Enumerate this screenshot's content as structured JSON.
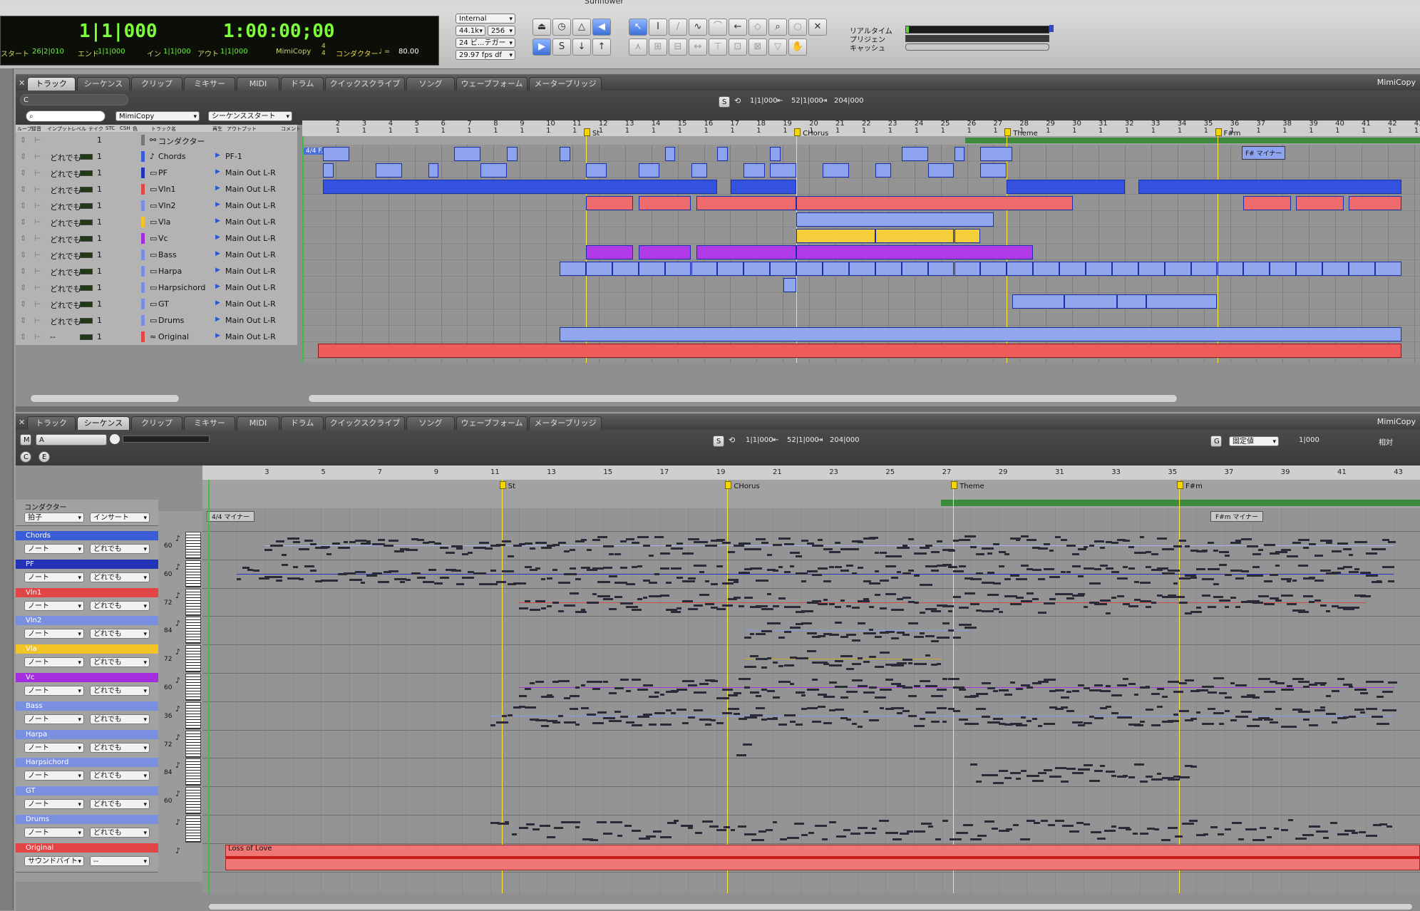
{
  "window_title": "Sunflower",
  "transport": {
    "counter_main": "1|1|000",
    "counter_time": "1:00:00;00",
    "start_label": "スタート",
    "start_value": "26|2|010",
    "end_label": "エンド",
    "end_value": "1|1|000",
    "in_label": "イン",
    "in_value": "1|1|000",
    "out_label": "アウト",
    "out_value": "1|1|000",
    "mode": "MimiCopy",
    "meter_top": "4",
    "meter_bottom": "4",
    "conductor_label": "コンダクター",
    "tempo_value": "80.00",
    "sync_source": "Internal",
    "sample_rate": "44.1k",
    "buffer": "256",
    "bit_depth": "24 ビ...テガー",
    "fps": "29.97 fps df",
    "realtime_label": "リアルタイム",
    "preroll_label": "プリジェン",
    "cache_label": "キャッシュ",
    "realtime_load": 0.02
  },
  "tabs": [
    "トラック",
    "シーケンス",
    "クリップ",
    "ミキサー",
    "MIDI",
    "ドラム",
    "クイックスクライブ",
    "ソング",
    "ウェーブフォーム",
    "メーターブリッジ"
  ],
  "top_window": {
    "active_tab": 0,
    "window_label": "MimiCopy",
    "label_c": "C",
    "search_placeholder": "",
    "seq_select": "MimiCopy",
    "start_select": "シーケンススタート",
    "counter_s": "S",
    "counter_start": "1|1|000",
    "counter_end": "52|1|000",
    "counter_len": "204|000",
    "columns": [
      "ループ",
      "録音",
      "インプット",
      "レベル",
      "テイク",
      "STC",
      "CSH",
      "色",
      "トラック名",
      "再生",
      "アウトプット",
      "コメント"
    ],
    "tracks": [
      {
        "input": "",
        "take": "1",
        "name": "コンダクター",
        "output": "",
        "color": "#777777"
      },
      {
        "input": "どれでも",
        "take": "1",
        "name": "Chords",
        "output": "PF-1",
        "color": "#3a5dd6"
      },
      {
        "input": "どれでも",
        "take": "1",
        "name": "PF",
        "output": "Main Out L-R",
        "color": "#2233b8"
      },
      {
        "input": "どれでも",
        "take": "1",
        "name": "Vln1",
        "output": "Main Out L-R",
        "color": "#e24545"
      },
      {
        "input": "どれでも",
        "take": "1",
        "name": "Vln2",
        "output": "Main Out L-R",
        "color": "#7b8fe0"
      },
      {
        "input": "どれでも",
        "take": "1",
        "name": "Vla",
        "output": "Main Out L-R",
        "color": "#f3c425"
      },
      {
        "input": "どれでも",
        "take": "1",
        "name": "Vc",
        "output": "Main Out L-R",
        "color": "#a52de0"
      },
      {
        "input": "どれでも",
        "take": "1",
        "name": "Bass",
        "output": "Main Out L-R",
        "color": "#7b8fe0"
      },
      {
        "input": "どれでも",
        "take": "1",
        "name": "Harpa",
        "output": "Main Out L-R",
        "color": "#7b8fe0"
      },
      {
        "input": "どれでも",
        "take": "1",
        "name": "Harpsichord",
        "output": "Main Out L-R",
        "color": "#7b8fe0"
      },
      {
        "input": "どれでも",
        "take": "1",
        "name": "GT",
        "output": "Main Out L-R",
        "color": "#7b8fe0"
      },
      {
        "input": "どれでも",
        "take": "1",
        "name": "Drums",
        "output": "Main Out L-R",
        "color": "#7b8fe0"
      },
      {
        "input": "--",
        "take": "1",
        "name": "Original",
        "output": "Main Out L-R",
        "color": "#e24545"
      }
    ],
    "markers": [
      {
        "label": "St",
        "measure": 12
      },
      {
        "label": "CHorus",
        "measure": 20
      },
      {
        "label": "Theme",
        "measure": 28
      },
      {
        "label": "F#m",
        "measure": 36
      }
    ],
    "conductor_text": "4/4 F...",
    "key_text": "F# マイナー"
  },
  "bottom_window": {
    "active_tab": 1,
    "window_label": "MimiCopy",
    "btn_m": "M",
    "btn_a": "A",
    "btn_c": "C",
    "btn_e": "E",
    "counter_s": "S",
    "counter_start": "1|1|000",
    "counter_end": "52|1|000",
    "counter_len": "204|000",
    "grid_g": "G",
    "grid_select": "固定値",
    "grid_value": "1|000",
    "relative_label": "相対",
    "conductor_name": "コンダクター",
    "conductor_select1": "拍子",
    "conductor_select2": "インサート",
    "meter_text": "4/4 マイナー",
    "key_text": "F#m マイナー",
    "audio_label": "Loss of Love",
    "tracks": [
      {
        "name": "Chords",
        "sel1": "ノート",
        "sel2": "どれでも",
        "pitch": "60",
        "color": "#3a5dd6"
      },
      {
        "name": "PF",
        "sel1": "ノート",
        "sel2": "どれでも",
        "pitch": "60",
        "color": "#2233b8"
      },
      {
        "name": "Vln1",
        "sel1": "ノート",
        "sel2": "どれでも",
        "pitch": "72",
        "color": "#e24545"
      },
      {
        "name": "Vln2",
        "sel1": "ノート",
        "sel2": "どれでも",
        "pitch": "84",
        "color": "#7b8fe0"
      },
      {
        "name": "Vla",
        "sel1": "ノート",
        "sel2": "どれでも",
        "pitch": "72",
        "color": "#f3c425"
      },
      {
        "name": "Vc",
        "sel1": "ノート",
        "sel2": "どれでも",
        "pitch": "60",
        "color": "#a52de0"
      },
      {
        "name": "Bass",
        "sel1": "ノート",
        "sel2": "どれでも",
        "pitch": "36",
        "color": "#7b8fe0"
      },
      {
        "name": "Harpa",
        "sel1": "ノート",
        "sel2": "どれでも",
        "pitch": "72",
        "color": "#7b8fe0"
      },
      {
        "name": "Harpsichord",
        "sel1": "ノート",
        "sel2": "どれでも",
        "pitch": "84",
        "color": "#7b8fe0"
      },
      {
        "name": "GT",
        "sel1": "ノート",
        "sel2": "どれでも",
        "pitch": "60",
        "color": "#7b8fe0"
      },
      {
        "name": "Drums",
        "sel1": "ノート",
        "sel2": "どれでも",
        "pitch": "",
        "color": "#7b8fe0"
      },
      {
        "name": "Original",
        "sel1": "サウンドバイト",
        "sel2": "--",
        "pitch": "",
        "color": "#e24545"
      }
    ]
  }
}
